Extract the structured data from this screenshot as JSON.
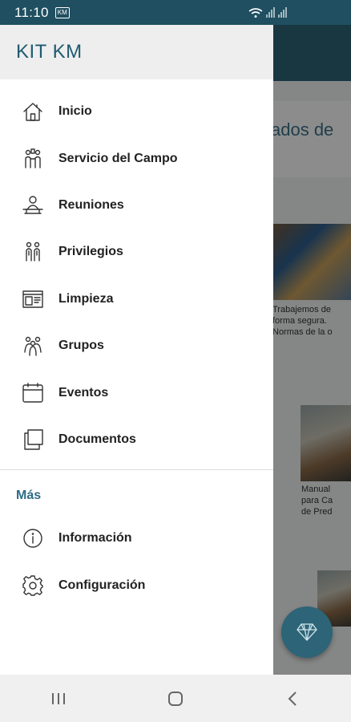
{
  "status_bar": {
    "time": "11:10",
    "notification_badge": "KM"
  },
  "drawer": {
    "title": "KIT KM",
    "items": [
      {
        "label": "Inicio",
        "icon": "home-icon"
      },
      {
        "label": "Servicio del Campo",
        "icon": "field-service-icon"
      },
      {
        "label": "Reuniones",
        "icon": "meetings-icon"
      },
      {
        "label": "Privilegios",
        "icon": "privileges-icon"
      },
      {
        "label": "Limpieza",
        "icon": "cleaning-icon"
      },
      {
        "label": "Grupos",
        "icon": "groups-icon"
      },
      {
        "label": "Eventos",
        "icon": "calendar-icon"
      },
      {
        "label": "Documentos",
        "icon": "documents-icon"
      }
    ],
    "section_title": "Más",
    "more_items": [
      {
        "label": "Información",
        "icon": "info-icon"
      },
      {
        "label": "Configuración",
        "icon": "gear-icon"
      }
    ]
  },
  "background": {
    "heading": "ados de",
    "card1_lines": [
      "Trabajemos de",
      "forma segura.",
      "Normas de la o"
    ],
    "card2_lines": [
      "Manual",
      "para Ca",
      "de Pred"
    ]
  },
  "colors": {
    "primary": "#2d6477",
    "accent_text": "#2d6c85"
  }
}
